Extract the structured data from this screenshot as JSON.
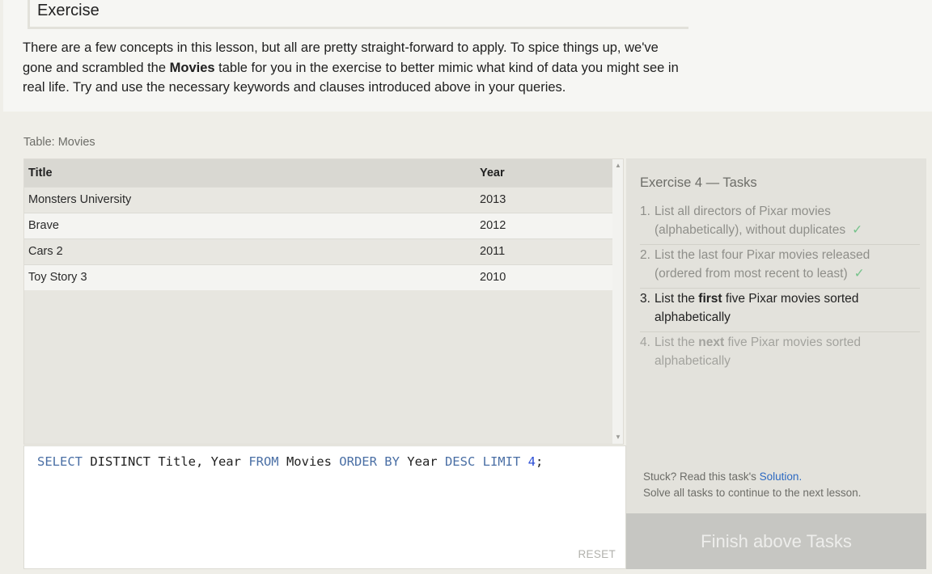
{
  "lesson": {
    "heading": "Exercise",
    "intro_part1": "There are a few concepts in this lesson, but all are pretty straight-forward to apply. To spice things up, we've gone and scrambled the ",
    "intro_bold": "Movies",
    "intro_part2": " table for you in the exercise to better mimic what kind of data you might see in real life. Try and use the necessary keywords and clauses introduced above in your queries."
  },
  "table": {
    "caption": "Table: Movies",
    "columns": [
      "Title",
      "Year"
    ],
    "rows": [
      {
        "title": "Monsters University",
        "year": "2013"
      },
      {
        "title": "Brave",
        "year": "2012"
      },
      {
        "title": "Cars 2",
        "year": "2011"
      },
      {
        "title": "Toy Story 3",
        "year": "2010"
      }
    ]
  },
  "editor": {
    "query": {
      "kw_select": "SELECT",
      "t_distinct": " DISTINCT Title, Year ",
      "kw_from": "FROM",
      "t_movies": " Movies ",
      "kw_orderby": "ORDER BY",
      "t_year": " Year ",
      "kw_desc": "DESC",
      "sp": " ",
      "kw_limit": "LIMIT",
      "sp2": " ",
      "n_limit": "4",
      "t_end": ";"
    },
    "reset_label": "RESET"
  },
  "tasks": {
    "title": "Exercise 4 — Tasks",
    "items": [
      {
        "num": "1.",
        "text": "List all directors of Pixar movies (alphabetically), without duplicates",
        "check": "✓"
      },
      {
        "num": "2.",
        "text": "List the last four Pixar movies released (ordered from most recent to least)",
        "check": "✓"
      },
      {
        "num": "3.",
        "pre": "List the ",
        "bold": "first",
        "post": " five Pixar movies sorted alphabetically"
      },
      {
        "num": "4.",
        "pre": "List the ",
        "bold": "next",
        "post": " five Pixar movies sorted alphabetically"
      }
    ],
    "stuck_prefix": "Stuck? Read this task's ",
    "solution_link": "Solution.",
    "continue_note": "Solve all tasks to continue to the next lesson.",
    "finish_label": "Finish above Tasks"
  },
  "colors": {
    "keyword": "#4a6fa5",
    "number": "#2c4fd6",
    "checkmark": "#77c38c",
    "link": "#2d6ac2",
    "finish_button_bg": "#c6c6c2"
  }
}
